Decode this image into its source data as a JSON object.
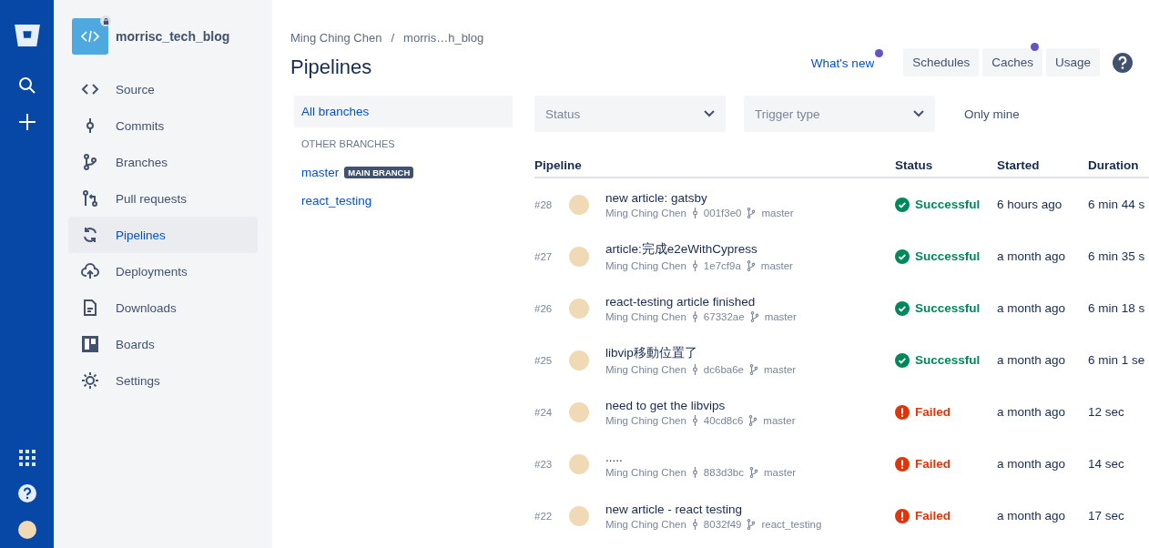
{
  "repository": {
    "name": "morrisc_tech_blog",
    "private": true
  },
  "sidebar": {
    "items": [
      {
        "label": "Source",
        "selected": false
      },
      {
        "label": "Commits",
        "selected": false
      },
      {
        "label": "Branches",
        "selected": false
      },
      {
        "label": "Pull requests",
        "selected": false
      },
      {
        "label": "Pipelines",
        "selected": true
      },
      {
        "label": "Deployments",
        "selected": false
      },
      {
        "label": "Downloads",
        "selected": false
      },
      {
        "label": "Boards",
        "selected": false
      },
      {
        "label": "Settings",
        "selected": false
      }
    ]
  },
  "breadcrumbs": [
    "Ming Ching Chen",
    "morris…h_blog"
  ],
  "breadcrumb_separator": "/",
  "page_title": "Pipelines",
  "header_actions": [
    {
      "label": "What's new",
      "kind": "link",
      "notification": true
    },
    {
      "label": "Schedules",
      "kind": "button",
      "notification": false
    },
    {
      "label": "Caches",
      "kind": "button",
      "notification": true
    },
    {
      "label": "Usage",
      "kind": "button",
      "notification": false
    }
  ],
  "branches": {
    "all": {
      "label": "All branches",
      "selected": true
    },
    "section_title": "OTHER BRANCHES",
    "items": [
      {
        "name": "master",
        "badge": "MAIN BRANCH",
        "selected": false
      },
      {
        "name": "react_testing",
        "selected": false
      }
    ]
  },
  "filters": [
    {
      "placeholder": "Status"
    },
    {
      "placeholder": "Trigger type"
    }
  ],
  "only_mine": "Only mine",
  "table": {
    "columns": [
      "Pipeline",
      "Status",
      "Started",
      "Duration"
    ],
    "rows": [
      {
        "number": "#28",
        "message": "new article: gatsby",
        "author": "Ming Ching Chen",
        "commit": "001f3e0",
        "branch": "master",
        "status": "Successful",
        "kind": "successful",
        "started": "6 hours ago",
        "duration": "6 min 44 s"
      },
      {
        "number": "#27",
        "message": "article:完成e2eWithCypress",
        "author": "Ming Ching Chen",
        "commit": "1e7cf9a",
        "branch": "master",
        "status": "Successful",
        "kind": "successful",
        "started": "a month ago",
        "duration": "6 min 35 s"
      },
      {
        "number": "#26",
        "message": "react-testing article finished",
        "author": "Ming Ching Chen",
        "commit": "67332ae",
        "branch": "master",
        "status": "Successful",
        "kind": "successful",
        "started": "a month ago",
        "duration": "6 min 18 s"
      },
      {
        "number": "#25",
        "message": "libvip移動位置了",
        "author": "Ming Ching Chen",
        "commit": "dc6ba6e",
        "branch": "master",
        "status": "Successful",
        "kind": "successful",
        "started": "a month ago",
        "duration": "6 min 1 se"
      },
      {
        "number": "#24",
        "message": "need to get the libvips",
        "author": "Ming Ching Chen",
        "commit": "40cd8c6",
        "branch": "master",
        "status": "Failed",
        "kind": "failed",
        "started": "a month ago",
        "duration": "12 sec"
      },
      {
        "number": "#23",
        "message": ".....",
        "author": "Ming Ching Chen",
        "commit": "883d3bc",
        "branch": "master",
        "status": "Failed",
        "kind": "failed",
        "started": "a month ago",
        "duration": "14 sec"
      },
      {
        "number": "#22",
        "message": "new article - react testing",
        "author": "Ming Ching Chen",
        "commit": "8032f49",
        "branch": "react_testing",
        "status": "Failed",
        "kind": "failed",
        "started": "a month ago",
        "duration": "17 sec"
      }
    ]
  }
}
